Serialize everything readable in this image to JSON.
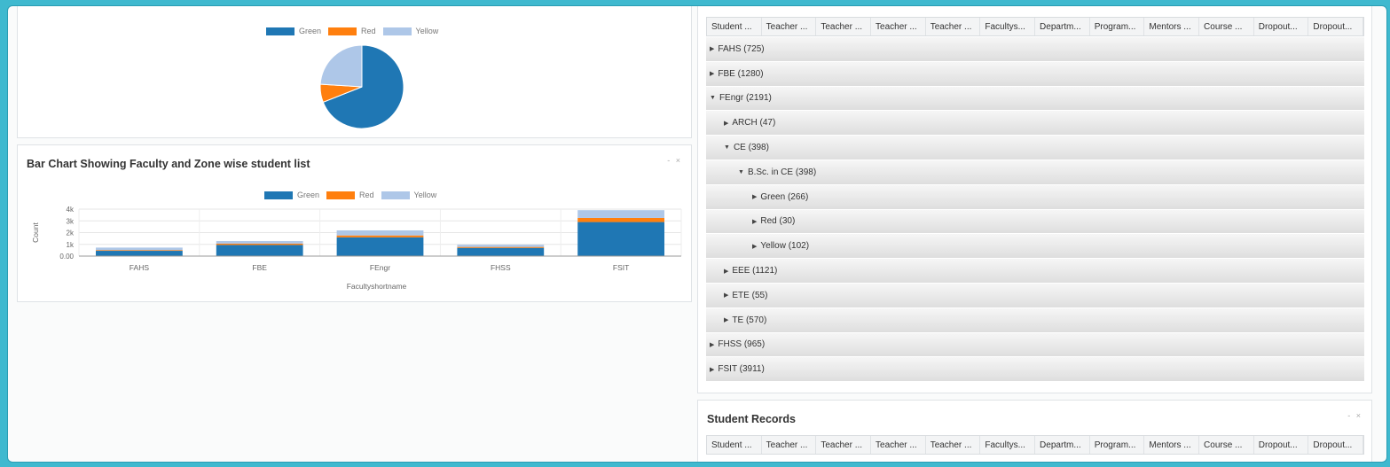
{
  "colors": {
    "green": "#1f77b4",
    "red": "#ff7f0e",
    "yellow": "#aec7e8"
  },
  "pie_panel": {
    "legend": [
      {
        "label": "Green",
        "color": "#1f77b4"
      },
      {
        "label": "Red",
        "color": "#ff7f0e"
      },
      {
        "label": "Yellow",
        "color": "#aec7e8"
      }
    ]
  },
  "bar_panel": {
    "title": "Bar Chart Showing Faculty and Zone wise student list",
    "window_controls": "- ×",
    "legend": [
      {
        "label": "Green",
        "color": "#1f77b4"
      },
      {
        "label": "Red",
        "color": "#ff7f0e"
      },
      {
        "label": "Yellow",
        "color": "#aec7e8"
      }
    ]
  },
  "chart_data": [
    {
      "type": "pie",
      "series": [
        {
          "name": "Green",
          "value": 0.69
        },
        {
          "name": "Red",
          "value": 0.07
        },
        {
          "name": "Yellow",
          "value": 0.24
        }
      ]
    },
    {
      "type": "bar",
      "stacked": true,
      "categories": [
        "FAHS",
        "FBE",
        "FEngr",
        "FHSS",
        "FSIT"
      ],
      "series": [
        {
          "name": "Green",
          "values": [
            450,
            950,
            1600,
            700,
            2900
          ]
        },
        {
          "name": "Red",
          "values": [
            60,
            110,
            160,
            80,
            350
          ]
        },
        {
          "name": "Yellow",
          "values": [
            215,
            220,
            431,
            185,
            661
          ]
        }
      ],
      "xlabel": "Facultyshortname",
      "ylabel": "Count",
      "ylim": [
        0,
        4000
      ],
      "yticks": [
        "0.00",
        "1k",
        "2k",
        "3k",
        "4k"
      ],
      "grid": true,
      "legend": "top-center"
    }
  ],
  "grid": {
    "columns": [
      "Student ...",
      "Teacher ...",
      "Teacher ...",
      "Teacher ...",
      "Teacher ...",
      "Facultys...",
      "Departm...",
      "Program...",
      "Mentors ...",
      "Course ...",
      "Dropout...",
      "Dropout..."
    ],
    "rows": [
      {
        "label": "FAHS (725)",
        "expanded": false,
        "level": 0
      },
      {
        "label": "FBE (1280)",
        "expanded": false,
        "level": 0
      },
      {
        "label": "FEngr (2191)",
        "expanded": true,
        "level": 0
      },
      {
        "label": "ARCH (47)",
        "expanded": false,
        "level": 1
      },
      {
        "label": "CE (398)",
        "expanded": true,
        "level": 1
      },
      {
        "label": "B.Sc. in CE (398)",
        "expanded": true,
        "level": 2
      },
      {
        "label": "Green (266)",
        "expanded": false,
        "level": 3
      },
      {
        "label": "Red (30)",
        "expanded": false,
        "level": 3
      },
      {
        "label": "Yellow (102)",
        "expanded": false,
        "level": 3
      },
      {
        "label": "EEE (1121)",
        "expanded": false,
        "level": 1
      },
      {
        "label": "ETE (55)",
        "expanded": false,
        "level": 1
      },
      {
        "label": "TE (570)",
        "expanded": false,
        "level": 1
      },
      {
        "label": "FHSS (965)",
        "expanded": false,
        "level": 0
      },
      {
        "label": "FSIT (3911)",
        "expanded": false,
        "level": 0
      }
    ]
  },
  "records_panel": {
    "title": "Student Records",
    "window_controls": "- ×",
    "columns": [
      "Student ...",
      "Teacher ...",
      "Teacher ...",
      "Teacher ...",
      "Teacher ...",
      "Facultys...",
      "Departm...",
      "Program...",
      "Mentors ...",
      "Course ...",
      "Dropout...",
      "Dropout..."
    ]
  }
}
